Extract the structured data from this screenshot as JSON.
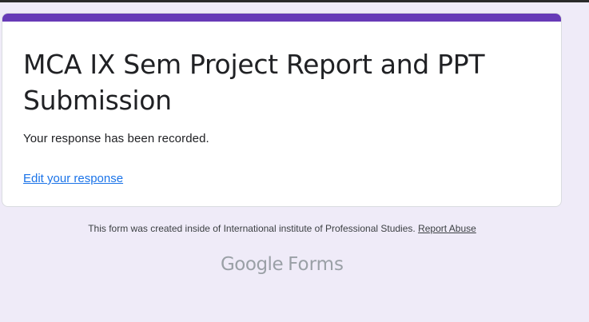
{
  "form": {
    "title": "MCA IX Sem Project Report and PPT Submission",
    "confirmation_message": "Your response has been recorded.",
    "edit_link_label": "Edit your response"
  },
  "footer": {
    "created_inside": "This form was created inside of International institute of Professional Studies.",
    "report_abuse_label": "Report Abuse",
    "brand_google": "Google",
    "brand_forms": "Forms"
  },
  "colors": {
    "accent": "#673ab7",
    "page_background": "#efebf8",
    "link": "#1a73e8"
  }
}
